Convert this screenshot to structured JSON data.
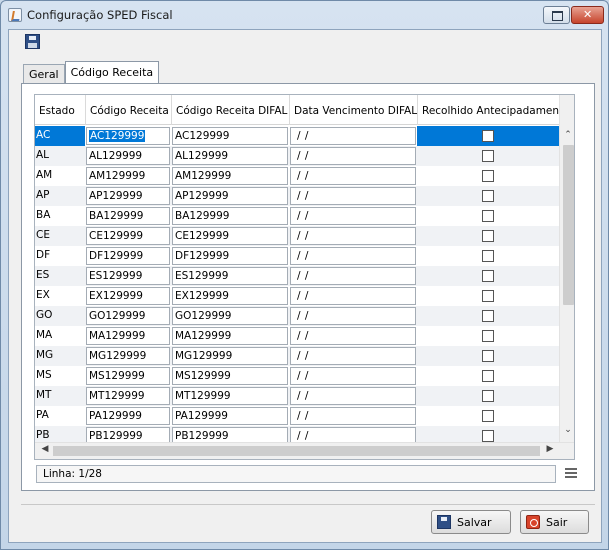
{
  "window": {
    "title": "Configuração SPED Fiscal"
  },
  "tabs": [
    {
      "label": "Geral",
      "active": false
    },
    {
      "label": "Código Receita",
      "active": true
    }
  ],
  "table": {
    "columns": [
      "Estado",
      "Código Receita",
      "Código Receita DIFAL",
      "Data Vencimento DIFAL",
      "Recolhido Antecipadamente"
    ],
    "rows": [
      {
        "uf": "AC",
        "codigo": "AC129999",
        "difal": "AC129999",
        "data": "/ /",
        "recolhido": false
      },
      {
        "uf": "AL",
        "codigo": "AL129999",
        "difal": "AL129999",
        "data": "/ /",
        "recolhido": false
      },
      {
        "uf": "AM",
        "codigo": "AM129999",
        "difal": "AM129999",
        "data": "/ /",
        "recolhido": false
      },
      {
        "uf": "AP",
        "codigo": "AP129999",
        "difal": "AP129999",
        "data": "/ /",
        "recolhido": false
      },
      {
        "uf": "BA",
        "codigo": "BA129999",
        "difal": "BA129999",
        "data": "/ /",
        "recolhido": false
      },
      {
        "uf": "CE",
        "codigo": "CE129999",
        "difal": "CE129999",
        "data": "/ /",
        "recolhido": false
      },
      {
        "uf": "DF",
        "codigo": "DF129999",
        "difal": "DF129999",
        "data": "/ /",
        "recolhido": false
      },
      {
        "uf": "ES",
        "codigo": "ES129999",
        "difal": "ES129999",
        "data": "/ /",
        "recolhido": false
      },
      {
        "uf": "EX",
        "codigo": "EX129999",
        "difal": "EX129999",
        "data": "/ /",
        "recolhido": false
      },
      {
        "uf": "GO",
        "codigo": "GO129999",
        "difal": "GO129999",
        "data": "/ /",
        "recolhido": false
      },
      {
        "uf": "MA",
        "codigo": "MA129999",
        "difal": "MA129999",
        "data": "/ /",
        "recolhido": false
      },
      {
        "uf": "MG",
        "codigo": "MG129999",
        "difal": "MG129999",
        "data": "/ /",
        "recolhido": false
      },
      {
        "uf": "MS",
        "codigo": "MS129999",
        "difal": "MS129999",
        "data": "/ /",
        "recolhido": false
      },
      {
        "uf": "MT",
        "codigo": "MT129999",
        "difal": "MT129999",
        "data": "/ /",
        "recolhido": false
      },
      {
        "uf": "PA",
        "codigo": "PA129999",
        "difal": "PA129999",
        "data": "/ /",
        "recolhido": false
      },
      {
        "uf": "PB",
        "codigo": "PB129999",
        "difal": "PB129999",
        "data": "/ /",
        "recolhido": false
      }
    ]
  },
  "status": {
    "text": "Linha: 1/28"
  },
  "buttons": {
    "save": "Salvar",
    "exit": "Sair"
  },
  "colors": {
    "selection": "#0078d7",
    "titlebar": "#c3d5e8"
  }
}
